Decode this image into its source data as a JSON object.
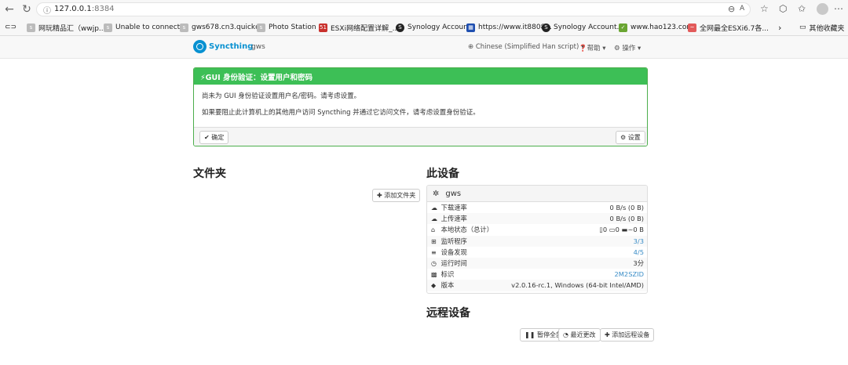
{
  "browser": {
    "url_host": "127.0.0.1",
    "url_port": ":8384",
    "bookmarks": [
      {
        "label": "网玩精品汇（wwjp...",
        "icon": "syncthing-favicon"
      },
      {
        "label": "Unable to connect...",
        "icon": "syncthing-favicon"
      },
      {
        "label": "gws678.cn3.quickc...",
        "icon": "syncthing-favicon"
      },
      {
        "label": "Photo Station 6",
        "icon": "syncthing-favicon"
      },
      {
        "label": "ESXi网络配置详解_...",
        "icon": "51cto-favicon"
      },
      {
        "label": "Synology Account",
        "icon": "synology-favicon"
      },
      {
        "label": "https://www.it8808...",
        "icon": "it8808-favicon"
      },
      {
        "label": "Synology Account...",
        "icon": "synology-favicon"
      },
      {
        "label": "www.hao123.com",
        "icon": "hao123-favicon"
      },
      {
        "label": "全网最全ESXi6.7各...",
        "icon": "esxi-favicon"
      }
    ],
    "other_bookmarks": "其他收藏夹"
  },
  "navbar": {
    "brand": "Syncthing",
    "device": "gws",
    "language": "Chinese (Simplified Han script)",
    "help": "帮助",
    "actions": "操作"
  },
  "alert": {
    "title": "GUI 身份验证：设置用户和密码",
    "line1": "尚未为 GUI 身份验证设置用户名/密码。请考虑设置。",
    "line2": "如果要阻止此计算机上的其他用户访问 Syncthing 并通过它访问文件，请考虑设置身份验证。",
    "ok": "确定",
    "settings": "设置"
  },
  "folders": {
    "heading": "文件夹",
    "add": "添加文件夹"
  },
  "this_device": {
    "heading": "此设备",
    "name": "gws",
    "rows": [
      {
        "label": "下载速率",
        "value": "0 B/s (0 B)",
        "icon": "download-cloud-icon"
      },
      {
        "label": "上传速率",
        "value": "0 B/s (0 B)",
        "icon": "upload-cloud-icon"
      },
      {
        "label": "本地状态（总计）",
        "value": "",
        "icon": "home-icon"
      },
      {
        "label": "监听程序",
        "value": "3/3",
        "icon": "sitemap-icon"
      },
      {
        "label": "设备发现",
        "value": "4/5",
        "icon": "signpost-icon"
      },
      {
        "label": "运行时间",
        "value": "3分",
        "icon": "clock-icon"
      },
      {
        "label": "标识",
        "value": "2M2SZID",
        "icon": "qrcode-icon"
      },
      {
        "label": "版本",
        "value": "v2.0.16-rc.1, Windows (64-bit Intel/AMD)",
        "icon": "tag-icon"
      }
    ],
    "local_state": {
      "files": "0",
      "dirs": "0",
      "size": "~0 B"
    }
  },
  "remote": {
    "heading": "远程设备",
    "pause_all": "暂停全部",
    "recent": "最近更改",
    "add": "添加远程设备"
  },
  "colors": {
    "accent": "#0891d1",
    "alert_green": "#3dbf56",
    "link": "#3a8dc7"
  }
}
